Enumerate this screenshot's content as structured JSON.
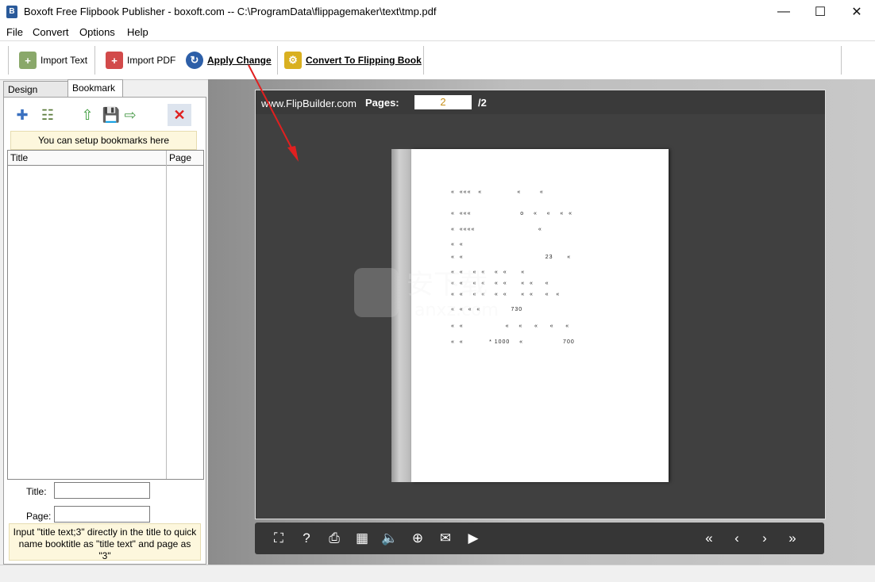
{
  "window": {
    "title": "Boxoft Free Flipbook Publisher - boxoft.com -- C:\\ProgramData\\flippagemaker\\text\\tmp.pdf",
    "app_icon": "book-icon",
    "minimize": "—",
    "maximize": "☐",
    "close": "✕"
  },
  "menu": [
    "File",
    "Convert",
    "Options",
    "Help"
  ],
  "toolbar": {
    "import_text": "Import Text",
    "import_pdf": "Import PDF",
    "apply_change": "Apply Change",
    "convert": "Convert To Flipping Book"
  },
  "left_panel": {
    "tabs": [
      "Design Setting",
      "Bookmark"
    ],
    "active_tab": "Bookmark",
    "hint": "You can setup bookmarks here",
    "columns": [
      "Title",
      "Page"
    ],
    "form": {
      "title_label": "Title:",
      "page_label": "Page:",
      "title_value": "",
      "page_value": ""
    },
    "form_hint": "Input \"title text;3\" directly in the title to quick name booktitle as \"title text\" and page as \"3\""
  },
  "viewer": {
    "site": "www.FlipBuilder.com",
    "pages_label": "Pages:",
    "current_page": "2",
    "total_pages": "/2",
    "page_rows": [
      "«  «««   «               «        «",
      "«  «««                     o    «    «    «  «",
      "«  ««««                           «",
      "«  «",
      "«  «                                   23      «",
      "«  «    «  «    «  «      «",
      "«  «    «  «    «  «      «  «     «",
      "«  «    «  «    «  «      «  «     «   «",
      "«  «  «  «             730",
      "«  «                  «    «     «     «     «",
      "«  «           * 1000    «                 700"
    ],
    "watermark_text": "安下载",
    "watermark_sub": "anxz.com"
  },
  "colors": {
    "accent_red": "#e02020",
    "viewer_bg": "#404040",
    "page_number": "#c8901a"
  }
}
